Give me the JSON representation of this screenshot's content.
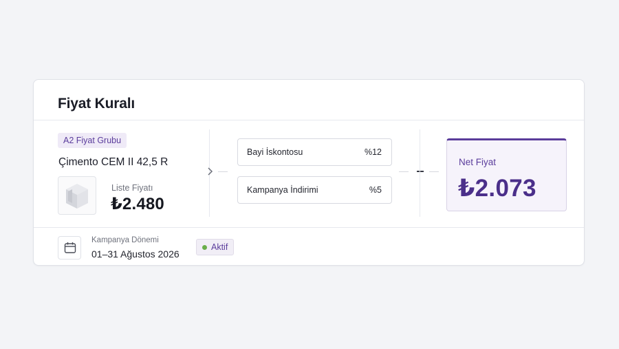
{
  "card": {
    "title": "Fiyat Kuralı"
  },
  "product": {
    "group_badge": "A2 Fiyat Grubu",
    "name": "Çimento CEM II 42,5 R",
    "list_price_label": "Liste Fiyatı",
    "list_price_value": "₺2.480",
    "thumbnail_icon": "cement-bag-icon"
  },
  "rules": [
    {
      "label": "Bayi İskontosu",
      "value": "%12"
    },
    {
      "label": "Kampanya İndirimi",
      "value": "%5"
    }
  ],
  "result": {
    "label": "Net Fiyat",
    "value": "₺2.073"
  },
  "campaign": {
    "period_label": "Kampanya Dönemi",
    "period_value": "01–31 Ağustos 2026",
    "status_label": "Aktif",
    "icon": "calendar-icon"
  },
  "colors": {
    "accent": "#5a3c9a",
    "accent_soft": "#f6f3fb",
    "status_active": "#6aae4a",
    "background": "#f3f4f7"
  }
}
